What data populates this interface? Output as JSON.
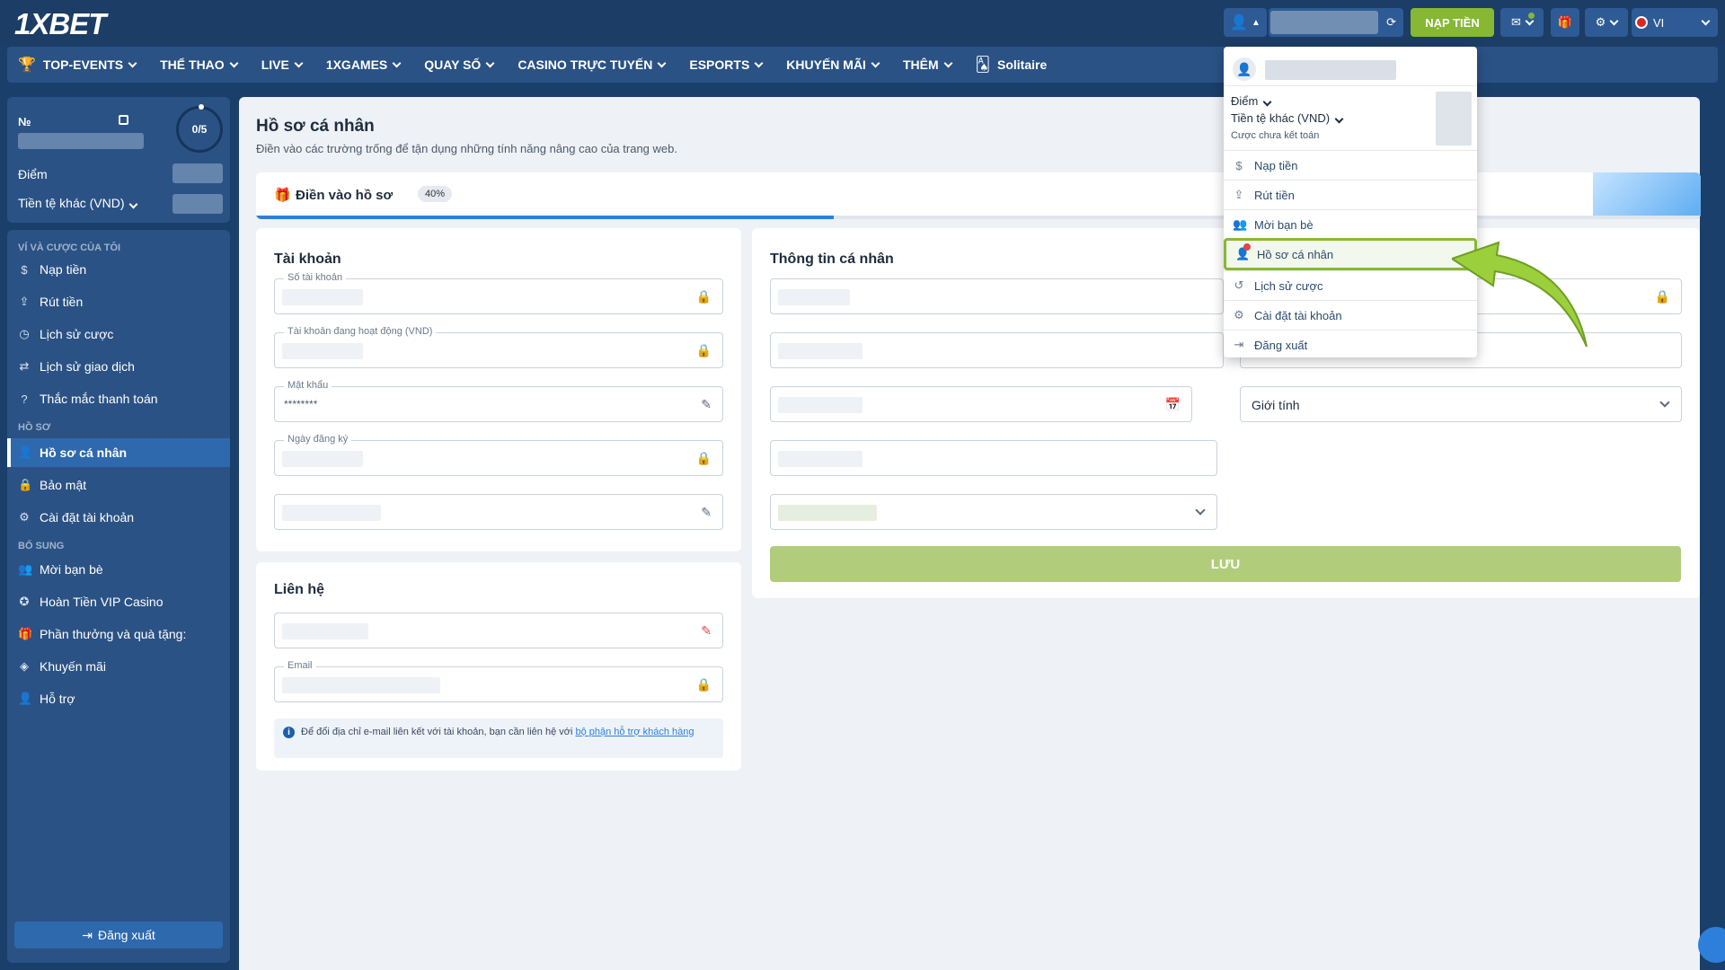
{
  "brand": {
    "logo": "1XBET"
  },
  "topbar": {
    "deposit": "NẠP TIỀN",
    "lang": "VI"
  },
  "nav": {
    "items": [
      "TOP-EVENTS",
      "THỂ THAO",
      "LIVE",
      "1XGAMES",
      "QUAY SỐ",
      "CASINO TRỰC TUYẾN",
      "ESPORTS",
      "KHUYẾN MÃI",
      "THÊM"
    ],
    "solitaire": "Solitaire"
  },
  "sidebar": {
    "no_label": "№",
    "progress": "0/5",
    "points": "Điểm",
    "currency": "Tiền tệ khác (VND)",
    "section_wallet": "VÍ VÀ CƯỢC CỦA TÔI",
    "section_profile": "HỒ SƠ",
    "section_extra": "BỔ SUNG",
    "wallet_items": [
      "Nạp tiền",
      "Rút tiền",
      "Lịch sử cược",
      "Lịch sử giao dịch",
      "Thắc mắc thanh toán"
    ],
    "profile_items": [
      "Hồ sơ cá nhân",
      "Bảo mật",
      "Cài đặt tài khoản"
    ],
    "extra_items": [
      "Mời bạn bè",
      "Hoàn Tiền VIP Casino",
      "Phần thưởng và quà tặng:",
      "Khuyến mãi",
      "Hỗ trợ"
    ],
    "logout": "Đăng xuất"
  },
  "main": {
    "title": "Hồ sơ cá nhân",
    "subtitle": "Điền vào các trường trống để tận dụng những tính năng nâng cao của trang web.",
    "fill_label": "Điền vào hồ sơ",
    "fill_percent": "40%",
    "fill_progress": 0.4,
    "account": {
      "title": "Tài khoản",
      "f_account_no": "Số tài khoản",
      "f_active": "Tài khoản đang hoạt động (VND)",
      "f_password": "Mật khẩu",
      "f_password_val": "********",
      "f_reg_date": "Ngày đăng ký"
    },
    "contact": {
      "title": "Liên hệ",
      "f_email": "Email",
      "info_text": "Để đổi địa chỉ e-mail liên kết với tài khoản, bạn cần liên hệ với ",
      "info_link": "bộ phận hỗ trợ khách hàng"
    },
    "personal": {
      "title": "Thông tin cá nhân",
      "gender": "Giới tính",
      "save": "LƯU"
    }
  },
  "dropdown": {
    "points": "Điểm",
    "currency": "Tiền tệ khác (VND)",
    "unsettled": "Cược chưa kết toán",
    "items": [
      "Nạp tiền",
      "Rút tiền",
      "Mời bạn bè",
      "Hồ sơ cá nhân",
      "Lịch sử cược",
      "Cài đặt tài khoản",
      "Đăng xuất"
    ]
  }
}
